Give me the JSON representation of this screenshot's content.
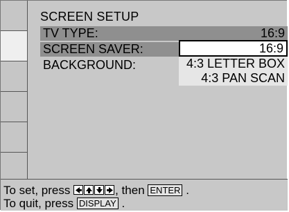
{
  "screen": {
    "title": "SCREEN SETUP",
    "rows": [
      {
        "label": "TV TYPE:",
        "value": "16:9"
      },
      {
        "label": "SCREEN SAVER:",
        "value": ""
      },
      {
        "label": "BACKGROUND:",
        "value": ""
      }
    ],
    "dropdown_options": [
      "16:9",
      "4:3 LETTER BOX",
      "4:3 PAN SCAN"
    ],
    "selected_option": "16:9"
  },
  "footer": {
    "line1_prefix": "To set, press",
    "line1_mid": ", then",
    "line1_key": "ENTER",
    "line1_suffix": ".",
    "line2_prefix": "To quit, press",
    "line2_key": "DISPLAY",
    "line2_suffix": ".",
    "arrow_keys": [
      "left-arrow-icon",
      "up-arrow-icon",
      "down-arrow-icon",
      "right-arrow-icon"
    ]
  }
}
